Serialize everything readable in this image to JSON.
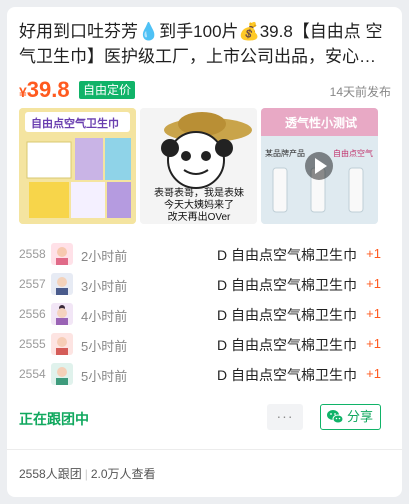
{
  "post": {
    "title": "好用到口吐芬芳💧到手100片💰39.8【自由点 空气卫生巾】医护级工厂，上市公司出品，安心…",
    "price_currency": "¥",
    "price_value": "39.8",
    "tag": "自由定价",
    "published": "14天前发布"
  },
  "images": {
    "img1_text": "自由点空气卫生巾",
    "img2_text_line1": "表哥表哥，我是表妹",
    "img2_text_line2": "今天大姨妈来了",
    "img2_text_line3": "改天再出OVer",
    "img3_text": "透气性小测试",
    "img3_sub_left": "某品牌产品",
    "img3_sub_right": "自由点空气"
  },
  "group_buys": [
    {
      "num": "2558",
      "ago": "2小时前",
      "product": "D 自由点空气棉卫生巾",
      "count": "+1"
    },
    {
      "num": "2557",
      "ago": "3小时前",
      "product": "D 自由点空气棉卫生巾",
      "count": "+1"
    },
    {
      "num": "2556",
      "ago": "4小时前",
      "product": "D 自由点空气棉卫生巾",
      "count": "+1"
    },
    {
      "num": "2555",
      "ago": "5小时前",
      "product": "D 自由点空气棉卫生巾",
      "count": "+1"
    },
    {
      "num": "2554",
      "ago": "5小时前",
      "product": "D 自由点空气棉卫生巾",
      "count": "+1"
    }
  ],
  "actions": {
    "following": "正在跟团中",
    "more": "···",
    "share": "分享"
  },
  "footer": {
    "followers": "2558人跟团",
    "views": "2.0万人查看"
  },
  "colors": {
    "accent_green": "#10b368",
    "price_orange": "#ff5a1f"
  }
}
